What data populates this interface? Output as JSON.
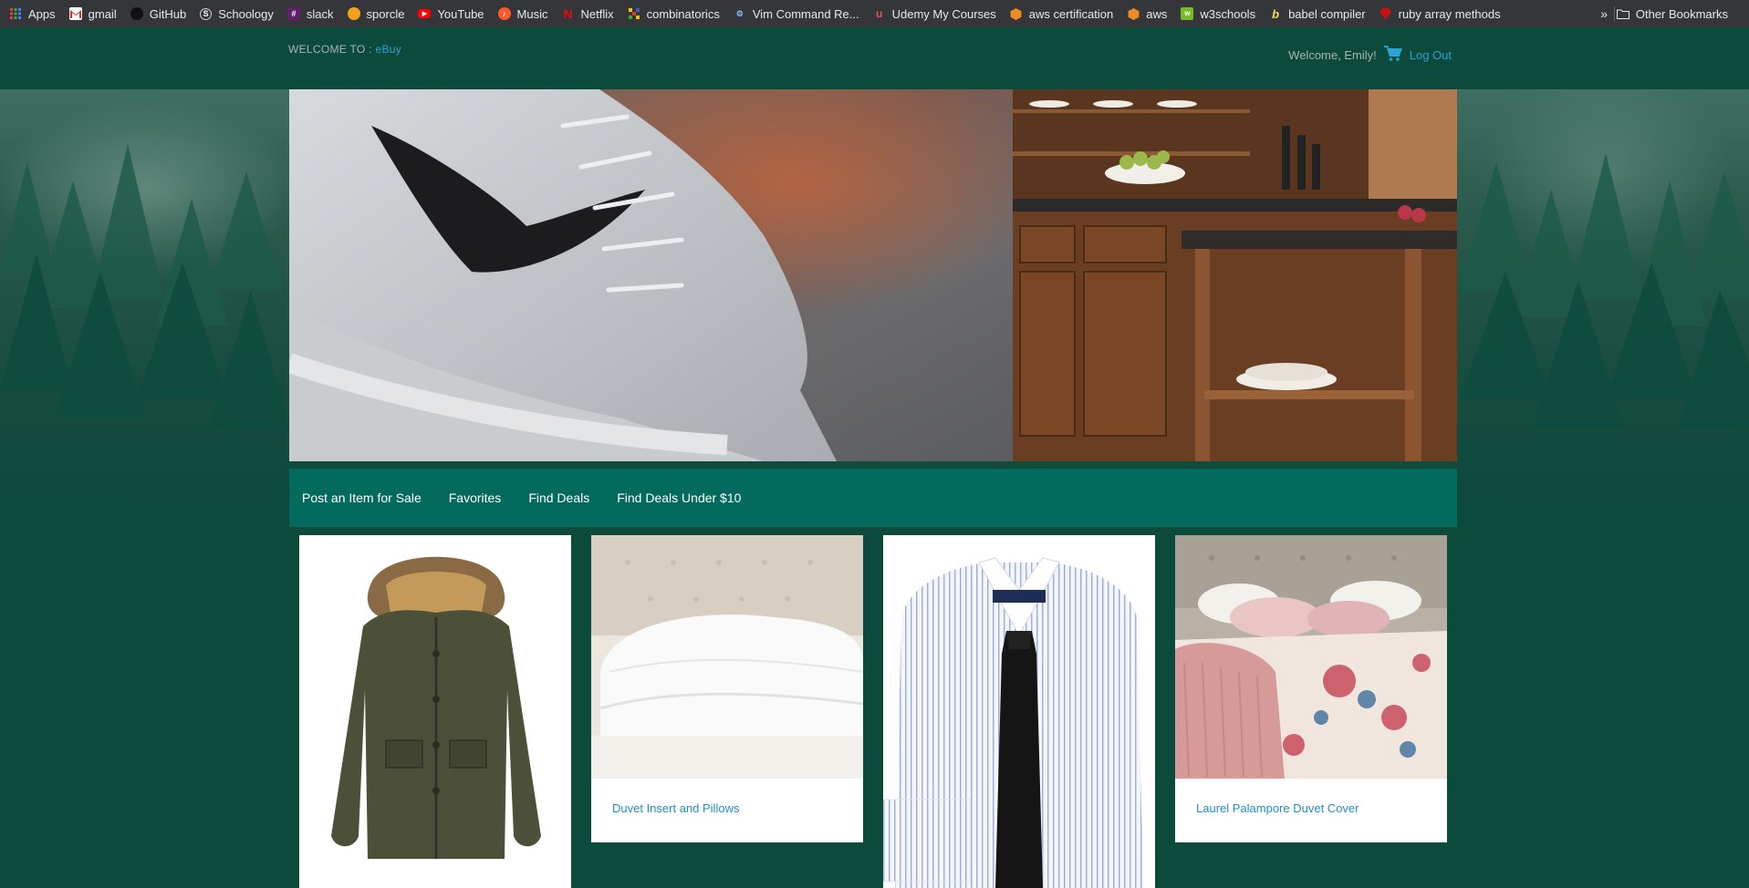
{
  "bookmarks": {
    "items": [
      {
        "label": "Apps",
        "icon": "apps-grid-icon",
        "color": "#e84235"
      },
      {
        "label": "gmail",
        "icon": "gmail-icon",
        "color": "#d93025"
      },
      {
        "label": "GitHub",
        "icon": "github-icon",
        "color": "#202124"
      },
      {
        "label": "Schoology",
        "icon": "schoology-icon",
        "color": "#4a8fd8"
      },
      {
        "label": "slack",
        "icon": "slack-icon",
        "color": "#611f69"
      },
      {
        "label": "sporcle",
        "icon": "sporcle-icon",
        "color": "#f4a21b"
      },
      {
        "label": "YouTube",
        "icon": "youtube-icon",
        "color": "#ff0000"
      },
      {
        "label": "Music",
        "icon": "music-icon",
        "color": "#fc5a2b"
      },
      {
        "label": "Netflix",
        "icon": "netflix-icon",
        "color": "#e50914"
      },
      {
        "label": "combinatorics",
        "icon": "combinatorics-icon",
        "color": "#f5c400"
      },
      {
        "label": "Vim Command Re...",
        "icon": "vim-icon",
        "color": "#5a7fb0"
      },
      {
        "label": "Udemy My Courses",
        "icon": "udemy-icon",
        "color": "#ec5252"
      },
      {
        "label": "aws certification",
        "icon": "aws-icon",
        "color": "#f08a24"
      },
      {
        "label": "aws",
        "icon": "aws-icon",
        "color": "#f08a24"
      },
      {
        "label": "w3schools",
        "icon": "w3schools-icon",
        "color": "#78b82a"
      },
      {
        "label": "babel compiler",
        "icon": "babel-icon",
        "color": "#f5da55"
      },
      {
        "label": "ruby array methods",
        "icon": "ruby-icon",
        "color": "#cc1010"
      }
    ],
    "overflow": "»",
    "other_label": "Other Bookmarks"
  },
  "header": {
    "welcome_prefix": "WELCOME TO : ",
    "brand": "eBuy",
    "greeting": "Welcome, Emily!",
    "logout_label": "Log Out"
  },
  "nav": {
    "items": [
      "Post an Item for Sale",
      "Favorites",
      "Find Deals",
      "Find Deals Under $10"
    ]
  },
  "products": [
    {
      "title": "",
      "image": "parka-jacket"
    },
    {
      "title": "Duvet Insert and Pillows",
      "image": "duvet-insert-pillows"
    },
    {
      "title": "",
      "image": "dress-shirt-tie"
    },
    {
      "title": "Laurel Palampore Duvet Cover",
      "image": "floral-duvet-bed"
    }
  ],
  "colors": {
    "background": "#0c4a3c",
    "nav": "#046a5e",
    "link": "#1f8fc5"
  }
}
